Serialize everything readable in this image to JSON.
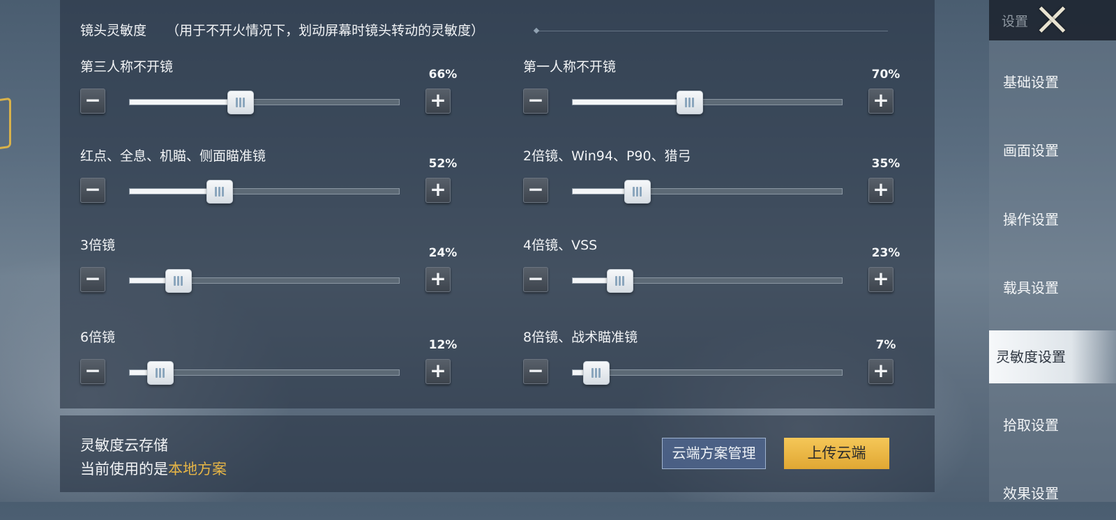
{
  "section": {
    "title": "镜头灵敏度",
    "subtitle": "（用于不开火情况下，划动屏幕时镜头转动的灵敏度）"
  },
  "settings": [
    {
      "label": "第三人称不开镜",
      "value": 66,
      "display": "66%"
    },
    {
      "label": "第一人称不开镜",
      "value": 70,
      "display": "70%"
    },
    {
      "label": "红点、全息、机瞄、侧面瞄准镜",
      "value": 52,
      "display": "52%"
    },
    {
      "label": "2倍镜、Win94、P90、猎弓",
      "value": 35,
      "display": "35%"
    },
    {
      "label": "3倍镜",
      "value": 24,
      "display": "24%"
    },
    {
      "label": "4倍镜、VSS",
      "value": 23,
      "display": "23%"
    },
    {
      "label": "6倍镜",
      "value": 12,
      "display": "12%"
    },
    {
      "label": "8倍镜、战术瞄准镜",
      "value": 7,
      "display": "7%"
    }
  ],
  "buttons": {
    "minus": "−",
    "plus": "+"
  },
  "cloud": {
    "title": "灵敏度云存储",
    "current_prefix": "当前使用的是",
    "current_value": "本地方案",
    "manage_label": "云端方案管理",
    "upload_label": "上传云端"
  },
  "sidebar": {
    "header": "设置",
    "items": [
      {
        "label": "基础设置",
        "active": false
      },
      {
        "label": "画面设置",
        "active": false
      },
      {
        "label": "操作设置",
        "active": false
      },
      {
        "label": "载具设置",
        "active": false
      },
      {
        "label": "灵敏度设置",
        "active": true
      },
      {
        "label": "拾取设置",
        "active": false
      },
      {
        "label": "效果设置",
        "active": false
      }
    ]
  },
  "colors": {
    "accent": "#e6b546",
    "upload_button": "#f0bb4a",
    "active_tab": "#f6f8fa"
  }
}
